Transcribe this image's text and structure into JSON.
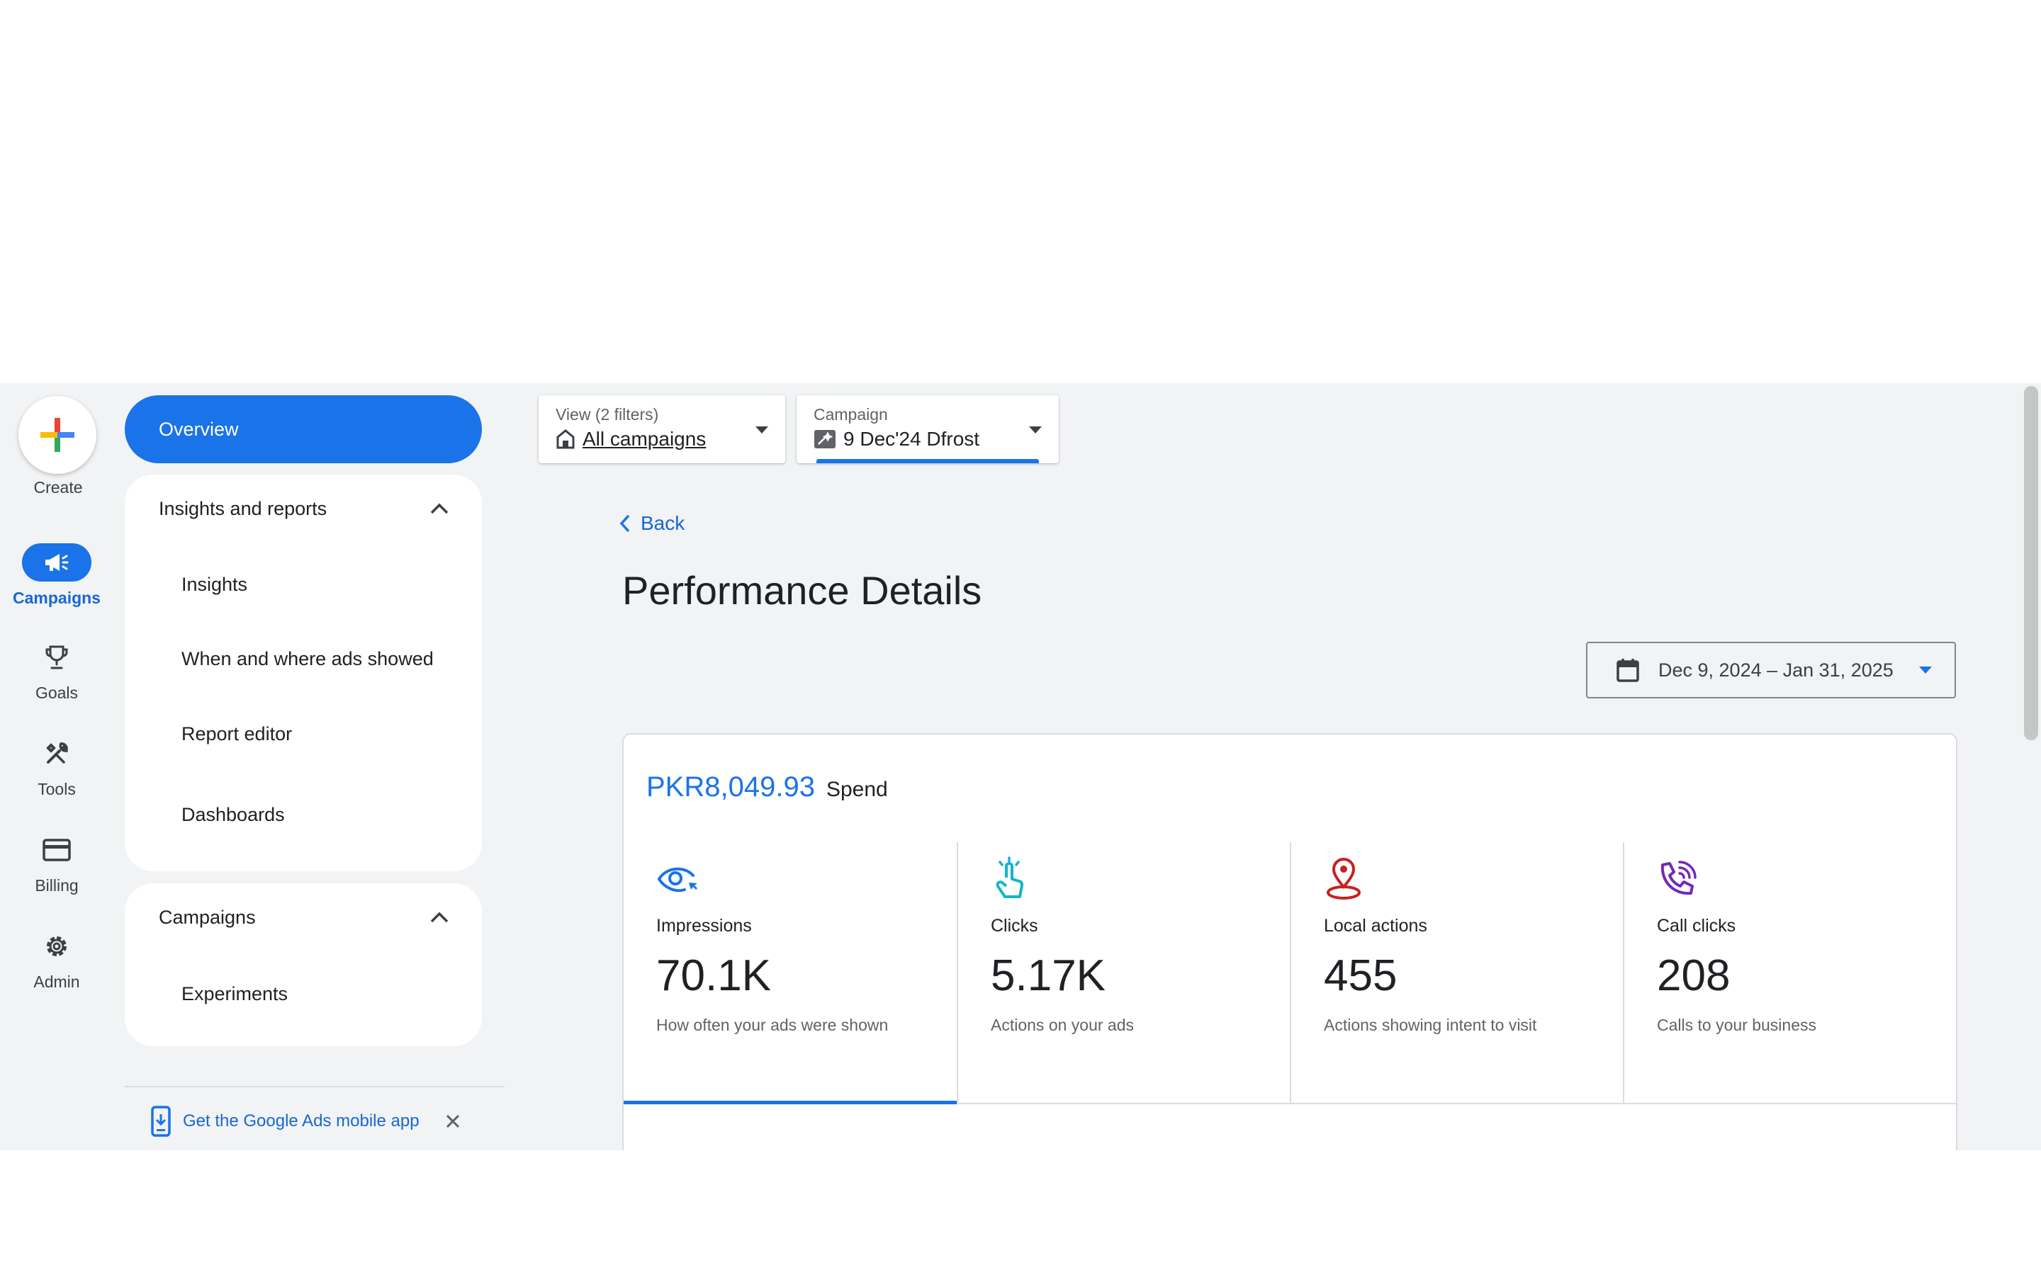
{
  "rail": {
    "create_label": "Create",
    "items": [
      {
        "label": "Campaigns",
        "icon": "megaphone-icon",
        "active": true
      },
      {
        "label": "Goals",
        "icon": "trophy-icon"
      },
      {
        "label": "Tools",
        "icon": "tools-icon"
      },
      {
        "label": "Billing",
        "icon": "credit-card-icon"
      },
      {
        "label": "Admin",
        "icon": "gear-icon"
      }
    ]
  },
  "nav": {
    "overview": "Overview",
    "insights_section": {
      "title": "Insights and reports",
      "items": [
        "Insights",
        "When and where ads showed",
        "Report editor",
        "Dashboards"
      ]
    },
    "campaigns_section": {
      "title": "Campaigns",
      "items": [
        "Experiments"
      ]
    },
    "mobile_app": "Get the Google Ads mobile app"
  },
  "filters": {
    "view": {
      "label": "View (2 filters)",
      "value": "All campaigns"
    },
    "campaign": {
      "label": "Campaign",
      "value": "9 Dec'24 Dfrost"
    }
  },
  "main": {
    "back": "Back",
    "title": "Performance Details",
    "date_range": "Dec 9, 2024 – Jan 31, 2025",
    "spend_amount": "PKR8,049.93",
    "spend_label": "Spend",
    "metrics": [
      {
        "name": "Impressions",
        "value": "70.1K",
        "desc": "How often your ads were shown",
        "color": "#1a73e8"
      },
      {
        "name": "Clicks",
        "value": "5.17K",
        "desc": "Actions on your ads",
        "color": "#12b5cb"
      },
      {
        "name": "Local actions",
        "value": "455",
        "desc": "Actions showing intent to visit",
        "color": "#c5221f"
      },
      {
        "name": "Call clicks",
        "value": "208",
        "desc": "Calls to your business",
        "color": "#7627bb"
      }
    ]
  },
  "colors": {
    "accent": "#1a73e8",
    "background": "#f1f3f4"
  }
}
